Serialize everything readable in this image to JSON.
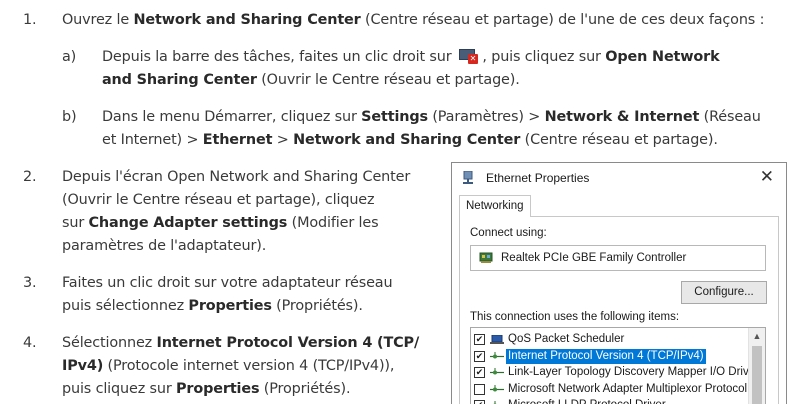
{
  "steps": [
    {
      "num": "1.",
      "line1": [
        {
          "t": "Ouvrez le ",
          "b": false
        },
        {
          "t": "Network and Sharing Center",
          "b": true
        },
        {
          "t": " (Centre réseau et partage) de l'une de ces deux façons :",
          "b": false
        }
      ],
      "subs": [
        {
          "letter": "a)",
          "line1_before": "Depuis la barre des tâches, faites un clic droit sur ",
          "line1_after_a": " , puis cliquez sur ",
          "line1_after_b": "Open Network",
          "line2_bold": "and Sharing Center",
          "line2_rest": " (Ouvrir le Centre réseau et partage)."
        },
        {
          "letter": "b)",
          "line1": [
            {
              "t": "Dans le menu Démarrer, cliquez sur ",
              "b": false
            },
            {
              "t": "Settings",
              "b": true
            },
            {
              "t": " (Paramètres) > ",
              "b": false
            },
            {
              "t": "Network & Internet",
              "b": true
            },
            {
              "t": " (Réseau",
              "b": false
            }
          ],
          "line2": [
            {
              "t": "et Internet) > ",
              "b": false
            },
            {
              "t": "Ethernet",
              "b": true
            },
            {
              "t": " > ",
              "b": false
            },
            {
              "t": "Network and Sharing Center",
              "b": true
            },
            {
              "t": " (Centre réseau et partage).",
              "b": false
            }
          ]
        }
      ]
    },
    {
      "num": "2.",
      "lines": [
        [
          {
            "t": "Depuis l'écran Open Network and Sharing Center",
            "b": false
          }
        ],
        [
          {
            "t": "(Ouvrir le Centre réseau et partage), cliquez",
            "b": false
          }
        ],
        [
          {
            "t": "sur ",
            "b": false
          },
          {
            "t": "Change Adapter settings",
            "b": true
          },
          {
            "t": " (Modifier les",
            "b": false
          }
        ],
        [
          {
            "t": "paramètres de l'adaptateur).",
            "b": false
          }
        ]
      ]
    },
    {
      "num": "3.",
      "lines": [
        [
          {
            "t": "Faites un clic droit sur votre adaptateur réseau",
            "b": false
          }
        ],
        [
          {
            "t": "puis sélectionnez ",
            "b": false
          },
          {
            "t": "Properties",
            "b": true
          },
          {
            "t": " (Propriétés).",
            "b": false
          }
        ]
      ]
    },
    {
      "num": "4.",
      "lines": [
        [
          {
            "t": "Sélectionnez ",
            "b": false
          },
          {
            "t": "Internet Protocol Version 4 (TCP/",
            "b": true
          }
        ],
        [
          {
            "t": "IPv4)",
            "b": true
          },
          {
            "t": " (Protocole internet version 4 (TCP/IPv4)),",
            "b": false
          }
        ],
        [
          {
            "t": "puis cliquez sur ",
            "b": false
          },
          {
            "t": "Properties",
            "b": true
          },
          {
            "t": " (Propriétés).",
            "b": false
          }
        ]
      ]
    }
  ],
  "dialog": {
    "title": "Ethernet Properties",
    "close_glyph": "✕",
    "tab": "Networking",
    "connect_using_label": "Connect using:",
    "adapter_name": "Realtek PCIe GBE Family Controller",
    "configure_button": "Configure...",
    "items_label": "This connection uses the following items:",
    "items": [
      {
        "label": "QoS Packet Scheduler",
        "checked": true,
        "icon": "qos-icon",
        "selected": false
      },
      {
        "label": "Internet Protocol Version 4 (TCP/IPv4)",
        "checked": true,
        "icon": "protocol-icon",
        "selected": true
      },
      {
        "label": "Link-Layer Topology Discovery Mapper I/O Driver",
        "checked": true,
        "icon": "protocol-icon",
        "selected": false
      },
      {
        "label": "Microsoft Network Adapter Multiplexor Protocol",
        "checked": false,
        "icon": "protocol-icon",
        "selected": false
      },
      {
        "label": "Microsoft LLDP Protocol Driver",
        "checked": true,
        "icon": "protocol-icon",
        "selected": false
      }
    ]
  },
  "colors": {
    "body_text": "#3a3a3a",
    "selection": "#0078d7",
    "tray_icon_alert": "#d6281e"
  }
}
